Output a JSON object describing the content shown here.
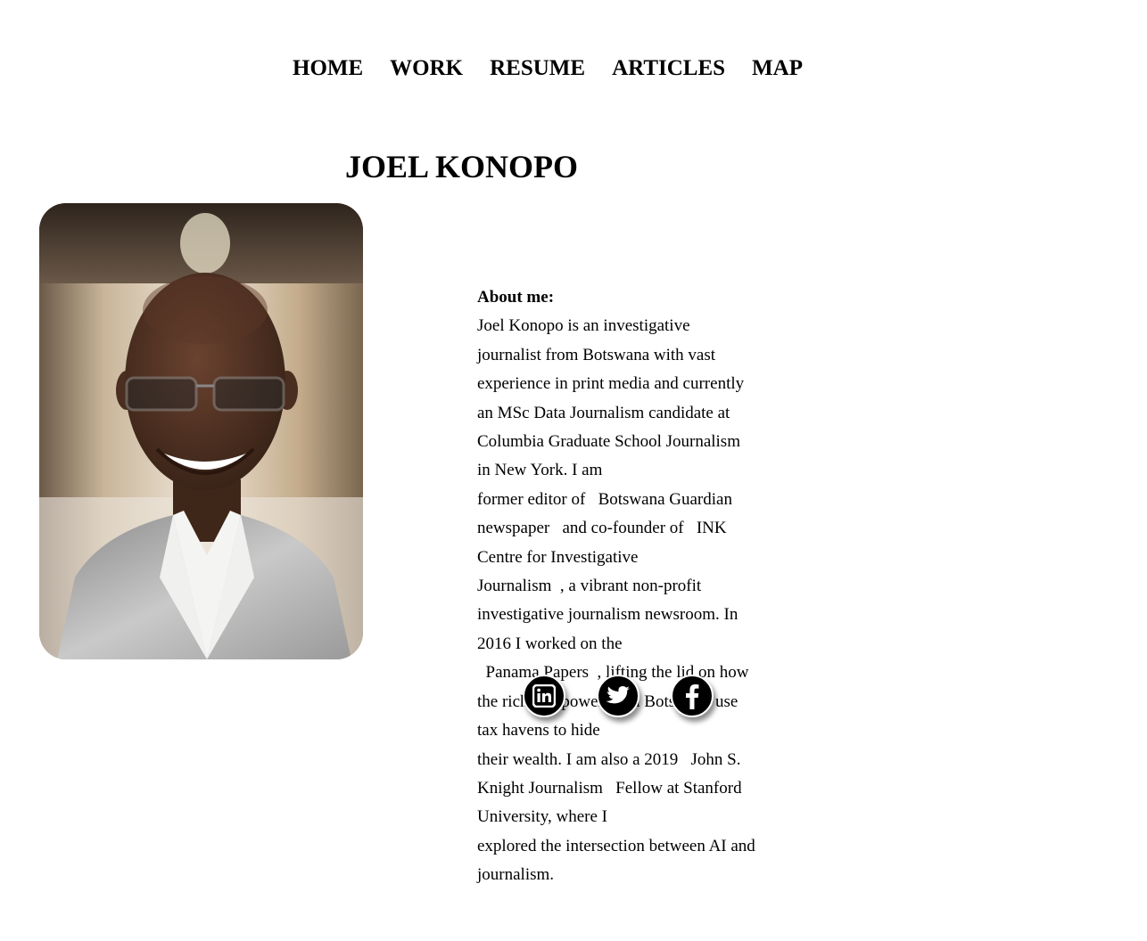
{
  "nav": {
    "items": [
      {
        "label": "HOME"
      },
      {
        "label": "WORK"
      },
      {
        "label": "RESUME"
      },
      {
        "label": "ARTICLES"
      },
      {
        "label": "MAP"
      }
    ]
  },
  "page_title": "JOEL KONOPO",
  "about": {
    "heading": "About me:",
    "lines": [
      "Joel Konopo is an investigative",
      "journalist from Botswana with vast",
      "experience in print media and currently",
      "an MSc Data Journalism candidate at",
      "Columbia Graduate School Journalism",
      "in New York. I am",
      "former editor of   Botswana Guardian",
      "newspaper   and co-founder of   INK",
      "Centre for Investigative",
      "Journalism  , a vibrant non-profit",
      "investigative journalism newsroom. In",
      "2016 I worked on the",
      "  Panama Papers  , lifting the lid on how",
      "the rich and powerful in Botswana use",
      "tax havens to hide",
      "their wealth. I am also a 2019   John S.",
      "Knight Journalism   Fellow at Stanford",
      "University, where I",
      "explored the intersection between AI and",
      "journalism."
    ]
  },
  "social": {
    "linkedin_icon": "linkedin-icon",
    "twitter_icon": "twitter-icon",
    "facebook_icon": "facebook-icon"
  },
  "colors": {
    "text": "#000000",
    "background": "#ffffff",
    "social_button": "#000000"
  }
}
